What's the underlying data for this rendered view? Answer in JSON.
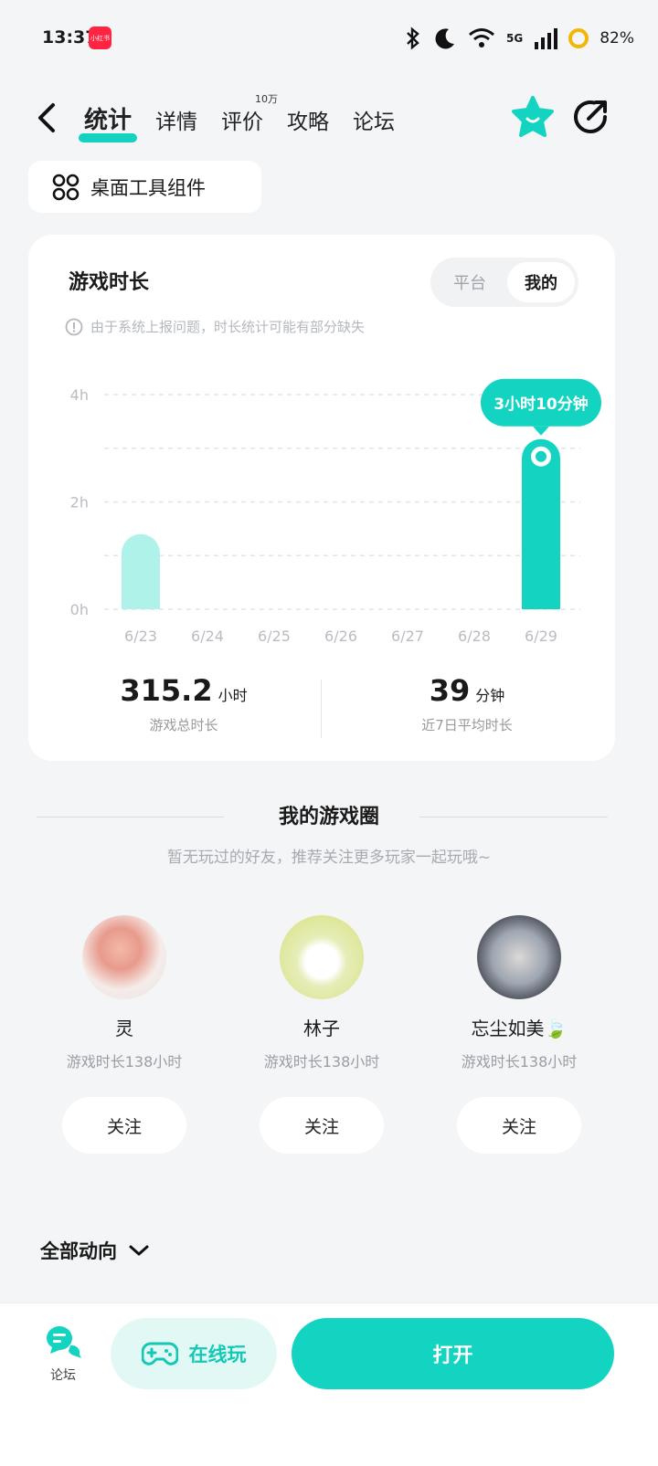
{
  "status_bar": {
    "time": "13:37",
    "app_badge": "小红书",
    "network": "5G",
    "battery": "82%"
  },
  "nav": {
    "tabs": [
      {
        "label": "统计",
        "active": true
      },
      {
        "label": "详情"
      },
      {
        "label": "评价",
        "badge": "10万"
      },
      {
        "label": "攻略"
      },
      {
        "label": "论坛"
      }
    ]
  },
  "widget": {
    "label": "桌面工具组件"
  },
  "stats": {
    "title": "游戏时长",
    "segments": [
      "平台",
      "我的"
    ],
    "selected_segment": "我的",
    "notice": "由于系统上报问题，时长统计可能有部分缺失",
    "tooltip": "3小时10分钟",
    "total": {
      "value": "315.2",
      "unit": "小时",
      "label": "游戏总时长"
    },
    "average": {
      "value": "39",
      "unit": "分钟",
      "label": "近7日平均时长"
    }
  },
  "chart_data": {
    "type": "bar",
    "categories": [
      "6/23",
      "6/24",
      "6/25",
      "6/26",
      "6/27",
      "6/28",
      "6/29"
    ],
    "values": [
      1.4,
      0,
      0,
      0,
      0,
      0,
      3.17
    ],
    "y_ticks": [
      "0h",
      "2h",
      "4h"
    ],
    "ylim": [
      0,
      4
    ],
    "highlight_index": 6,
    "colors": {
      "normal": "#aef2ea",
      "highlight": "#13d3c1"
    }
  },
  "circle": {
    "title": "我的游戏圈",
    "subtitle": "暂无玩过的好友，推荐关注更多玩家一起玩哦~",
    "users": [
      {
        "name": "灵",
        "info": "游戏时长138小时",
        "follow": "关注"
      },
      {
        "name": "林子",
        "info": "游戏时长138小时",
        "follow": "关注"
      },
      {
        "name": "忘尘如美🍃",
        "info": "游戏时长138小时",
        "follow": "关注"
      }
    ]
  },
  "feed": {
    "label": "全部动向"
  },
  "bottom": {
    "forum": "论坛",
    "cloud_play": "在线玩",
    "open": "打开"
  },
  "colors": {
    "accent": "#13d3c1",
    "accent_light": "#aef2ea",
    "background": "#f4f5f7"
  }
}
